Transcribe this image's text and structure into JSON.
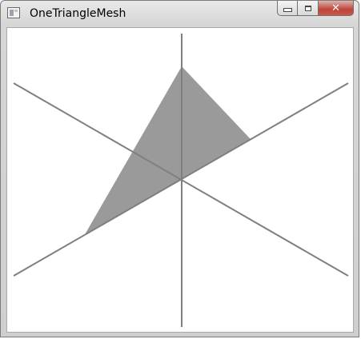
{
  "window": {
    "title": "OneTriangleMesh"
  },
  "caption_buttons": {
    "minimize_icon": "minimize-icon",
    "maximize_icon": "maximize-icon",
    "close_icon": "close-icon",
    "close_glyph": "✕"
  },
  "colors": {
    "triangle_fill": "#9a9a9a",
    "axis_stroke": "#7f7f7f",
    "close_button": "#c0433a"
  }
}
